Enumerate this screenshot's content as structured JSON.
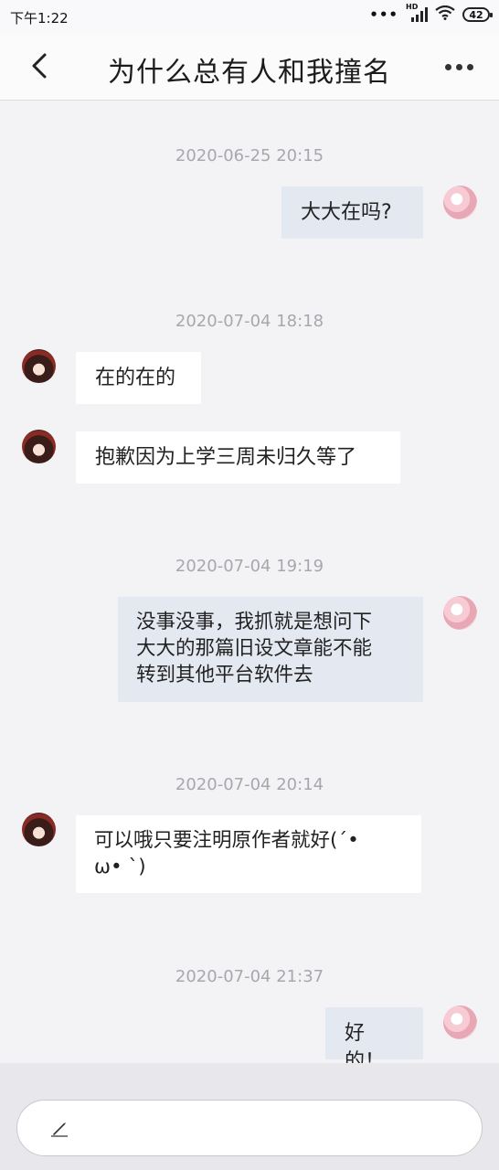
{
  "status_bar": {
    "time": "下午1:22",
    "dots": "•••",
    "network": "HD",
    "battery": "42"
  },
  "header": {
    "title": "为什么总有人和我撞名"
  },
  "messages": [
    {
      "timestamp": "2020-06-25 20:15",
      "sender": "me",
      "text": "大大在吗?"
    },
    {
      "timestamp": "2020-07-04 18:18",
      "sender": "other",
      "text": "在的在的"
    },
    {
      "sender": "other",
      "text": "抱歉因为上学三周未归久等了"
    },
    {
      "timestamp": "2020-07-04 19:19",
      "sender": "me",
      "text": "没事没事，我抓就是想问下\n大大的那篇旧设文章能不能\n转到其他平台软件去"
    },
    {
      "timestamp": "2020-07-04 20:14",
      "sender": "other",
      "text": "可以哦只要注明原作者就好(´•\nω• `)"
    },
    {
      "timestamp": "2020-07-04 21:37",
      "sender": "me",
      "text": "好的！"
    }
  ],
  "input": {
    "placeholder": ""
  },
  "colors": {
    "background": "#f3f3f6",
    "my_bubble": "#e4e8f0",
    "other_bubble": "#ffffff",
    "timestamp": "#a7a7ad"
  }
}
